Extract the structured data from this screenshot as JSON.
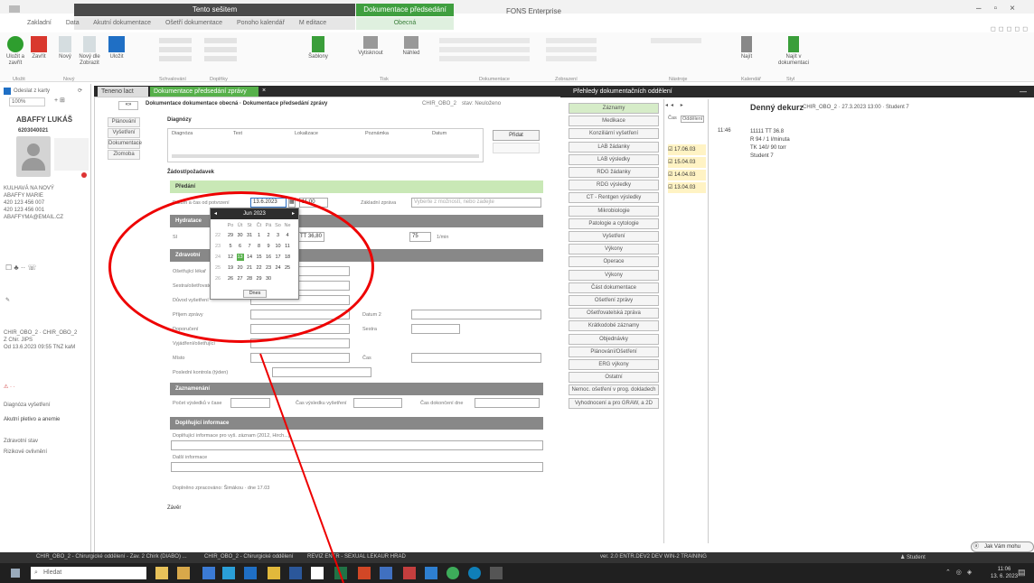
{
  "titlebar": {
    "context_tab_left": "Tento sešitem",
    "context_tab_right": "Dokumentace předsedání zprávy",
    "context_sub_right": "Obecná",
    "window_title": "FONS Enterprise",
    "tabs": [
      "Zakladní",
      "Data",
      "Akutní dokumentace",
      "Ošetří dokumentace",
      "Ponoho kalendář",
      "M editace"
    ]
  },
  "ribbon": {
    "buttons": [
      {
        "label": "Uložit a zavřít",
        "icon": "check-icon",
        "color": "#2e9e2e"
      },
      {
        "label": "Zavřít",
        "icon": "close-icon",
        "color": "#d9382e"
      },
      {
        "label": "Nový",
        "icon": "new-doc-icon",
        "color": "#9aa"
      },
      {
        "label": "Nový dle Zobrazit",
        "icon": "copy-icon",
        "color": "#9aa"
      },
      {
        "label": "Uložit",
        "icon": "save-icon",
        "color": "#1f6fc5"
      },
      {
        "label": "Vytisknout",
        "icon": "print-icon",
        "color": "#777"
      },
      {
        "label": "Náhled",
        "icon": "preview-icon",
        "color": "#777"
      },
      {
        "label": "Najít",
        "icon": "find-icon",
        "color": "#777"
      },
      {
        "label": "Najít v dokumentaci",
        "icon": "search-doc-icon",
        "color": "#777"
      },
      {
        "label": "Šablony",
        "icon": "template-icon",
        "color": "#3a9e3a"
      }
    ],
    "groups": [
      "Uložit",
      "Nový",
      "Schvalování",
      "Doplňky",
      "Tisk",
      "Dokumentace",
      "Zobrazení",
      "Nástroje",
      "Kalendář",
      "Styl"
    ]
  },
  "left_panel": {
    "top_label": "Odeslat z karty",
    "zoom": "100%",
    "patient_name": "ABAFFY LUKÁŠ",
    "patient_id": "6203040021",
    "lines": [
      "KULHAVÁ NA NOVÝ",
      "ABAFFY MARIE",
      "420 123 456 007",
      "420 123 456 001",
      "ABAFFYMA@EMAIL.CZ"
    ],
    "codes": [
      "CHIR_OBO_2 · CHIR_OBO_2",
      "Z  Chir. JIPS",
      "Od 13.6.2023 09:55 TNZ kaM"
    ],
    "footer_lines": [
      "Diagnóza vyšetření",
      "Akutní pletivo a anemie",
      "Zdravotní stav",
      "Rizikové ovlivnění"
    ]
  },
  "doc_tabs": {
    "tab1": "Teneno lact",
    "tab2": "Dokumentace předsedání zprávy"
  },
  "form": {
    "breadcrumb": "Dokumentace dokumentace obecná · Dokumentace předsedání zprávy",
    "breadcrumb_code": "CHIR_OBO_2",
    "breadcrumb_status": "stav: Neuloženo",
    "vnav": [
      "Plánování",
      "Vyšetření",
      "Dokumentace",
      "Zlomoba"
    ],
    "sections": {
      "diagnosis": "Diagnózy",
      "diag_cols": [
        "Diagnóza",
        "Text",
        "Lokalizace",
        "Poznámka",
        "Datum"
      ],
      "diag_button": "Přidat",
      "request": "Žádost/požadavek",
      "fulfillment": "Předání",
      "hydration": "Hydratace",
      "examination": "Zdravotní",
      "notes": "Zaznamenání",
      "additional": "Doplňující informace",
      "conclusion": "Závěr"
    },
    "labels": {
      "date_label": "Datum a čas od potvrzení",
      "date_value": "13.6.2023",
      "time_value": "11:00",
      "field_two": "Základní zpráva",
      "field_two_placeholder": "Vyberte z možností, nebo zadejte",
      "vital_t": "TT 36,80",
      "vital_ps": "SI",
      "vital_ps_value": "75",
      "vital_units": "1/min",
      "row_labels": [
        "Ošetřující lékař",
        "Sestra/ošetřovatel",
        "Důvod vyšetření",
        "Příjem zprávy",
        "Doporučení",
        "Vyjádření/ošetřující",
        "Místo",
        "Poslední kontrola (týden)"
      ],
      "side_labels": [
        "Datum 2",
        "Sestra",
        "Čas"
      ],
      "notes_labels": [
        "Počet výsledků v čase",
        "Čas výsledku vyšetření",
        "Čas dokončení dne"
      ],
      "additional_label": "Doplňující informace pro vyš. záznam (2012, Hirch...)",
      "additional_label2": "Další informace",
      "footer_note": "Doplněno zpracováno: Šimákou · dne 17.03"
    }
  },
  "calendar": {
    "header": "Jun 2023",
    "weekdays": [
      "Po",
      "Út",
      "St",
      "Čt",
      "Pá",
      "So",
      "Ne"
    ],
    "weeks": [
      [
        "22",
        "29",
        "30",
        "31",
        "1",
        "2",
        "3",
        "4"
      ],
      [
        "23",
        "5",
        "6",
        "7",
        "8",
        "9",
        "10",
        "11"
      ],
      [
        "24",
        "12",
        "13",
        "14",
        "15",
        "16",
        "17",
        "18"
      ],
      [
        "25",
        "19",
        "20",
        "21",
        "22",
        "23",
        "24",
        "25"
      ],
      [
        "26",
        "26",
        "27",
        "28",
        "29",
        "30",
        "",
        ""
      ]
    ],
    "selected_day": "13",
    "today_button": "Dnes"
  },
  "right_panel": {
    "title": "Přehledy dokumentačních oddělení",
    "nav": [
      "Záznamy",
      "Medikace",
      "Konziliární vyšetření",
      "LAB žádanky",
      "LAB výsledky",
      "RDG žádanky",
      "RDG výsledky",
      "CT - Rentgen výsledky",
      "Mikrobiologie",
      "Patologie a cytologie",
      "Vyšetření",
      "Výkony",
      "Operace",
      "Výkony",
      "Část dokumentace",
      "Ošetření zprávy",
      "Ošetřovatelská zpráva",
      "Krátkodobé záznamy",
      "Objednávky",
      "Plánování/Ošetření",
      "ERG výkony",
      "Ostatní",
      "Nemoc. ošetření v prog. dokladech",
      "Vyhodnocení a pro GRAW, a 2D"
    ],
    "active_nav": "Záznamy",
    "list_header_cols": [
      "Čas",
      "Oddělení"
    ],
    "list_rows": [
      "17.06.03",
      "15.04.03",
      "14.04.03",
      "13.04.03"
    ],
    "detail_title": "Denný dekurz",
    "detail_meta": "CHIR_OBO_2 · 27.3.2023 13:00 · Student 7",
    "detail_time": "11:46",
    "detail_lines": [
      "11111 TT 36.8",
      "R 94 / 1 l/minuta",
      "TK 140/ 90 torr",
      "Student 7"
    ]
  },
  "taskbar": {
    "top_items": [
      "CHIR_OBO_2 - Chirurgické oddělení - Zav. 2 Chirk (DIABO) ...",
      "CHIR_OBO_2 - Chirurgické oddělení",
      "REVIZ ENTR - SEXUAL LEKAUR HRAD",
      "ver. 2.0 ENTR.DEV2 DEV WIN-2 TRAINING"
    ],
    "user": "Student",
    "search_placeholder": "Hledat",
    "assist": "Jak Vám mohu pomoci?",
    "time": "11:06",
    "date": "13. 6. 2023"
  }
}
